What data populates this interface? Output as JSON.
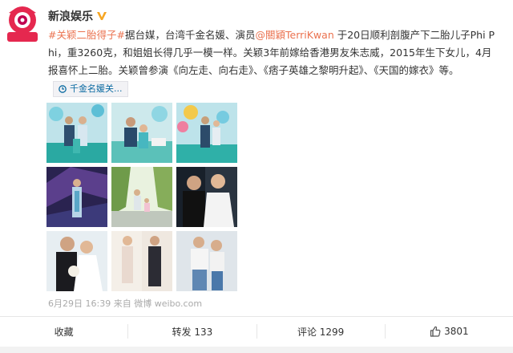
{
  "author": {
    "name": "新浪娱乐"
  },
  "post": {
    "topic1": "#关颖二胎",
    "topic2": "得子",
    "topic3": "#",
    "text_a": "据台媒，台湾千金名媛、演员",
    "mention": "@關穎TerriKwan",
    "text_b": " 于20日顺利剖腹产下二胎儿子Phi Phi，重3260克，和姐姐长得几乎一模一样。关颖3年前嫁给香港男友朱志威，2015年生下女儿，4月报喜怀上二胎。关颖曾参演《向左走、向右走》、《痞子英雄之黎明升起》、《天国的嫁衣》等。",
    "chip": "千金名媛关..."
  },
  "meta": {
    "time": "6月29日 16:39",
    "from_label": "来自",
    "source": "微博 weibo.com"
  },
  "actions": {
    "favorite": "收藏",
    "repost": "转发 133",
    "comment": "评论 1299",
    "like": "3801"
  },
  "colors": {
    "accent": "#eb7350",
    "link": "#0a6aa1"
  }
}
